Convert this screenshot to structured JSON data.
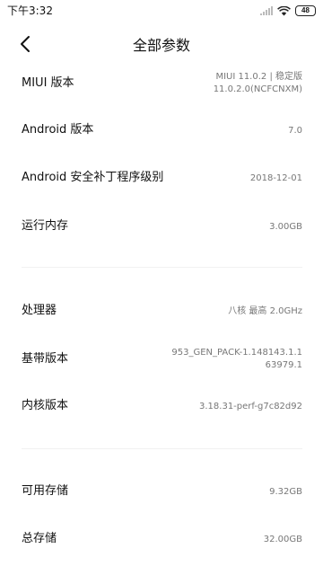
{
  "status_bar": {
    "time": "下午3:32",
    "battery": "48",
    "icons": [
      "signal-icon",
      "wifi-icon",
      "battery-icon"
    ]
  },
  "header": {
    "back_icon": "chevron-left-icon",
    "title": "全部参数"
  },
  "specs": {
    "miui": {
      "label": "MIUI 版本",
      "value_line1": "MIUI 11.0.2 | 稳定版",
      "value_line2": "11.0.2.0(NCFCNXM)"
    },
    "android": {
      "label": "Android 版本",
      "value": "7.0"
    },
    "security_patch": {
      "label": "Android 安全补丁程序级别",
      "value": "2018-12-01"
    },
    "ram": {
      "label": "运行内存",
      "value": "3.00GB"
    },
    "processor": {
      "label": "处理器",
      "value": "八核 最高 2.0GHz"
    },
    "baseband": {
      "label": "基带版本",
      "value_line1": "953_GEN_PACK-1.148143.1.1",
      "value_line2": "63979.1"
    },
    "kernel": {
      "label": "内核版本",
      "value": "3.18.31-perf-g7c82d92"
    },
    "available_storage": {
      "label": "可用存储",
      "value": "9.32GB"
    },
    "total_storage": {
      "label": "总存储",
      "value": "32.00GB"
    }
  },
  "colors": {
    "label_text": "#111111",
    "value_text": "#777777",
    "divider": "#f1f1f1",
    "background": "#ffffff"
  }
}
